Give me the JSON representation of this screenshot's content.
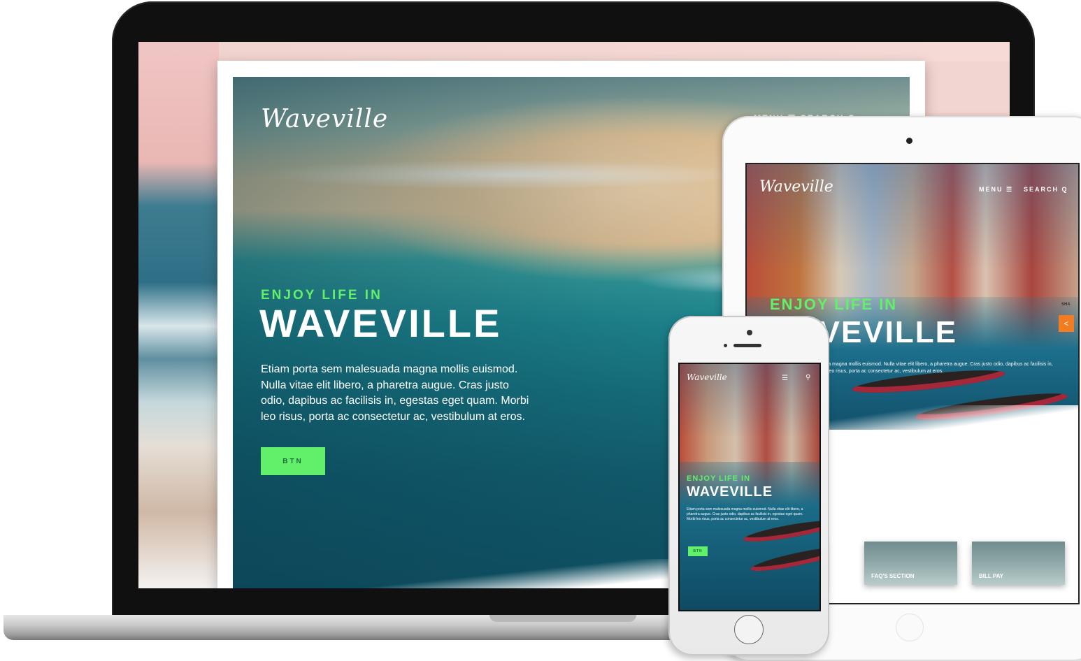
{
  "laptop": {
    "logo": "Waveville",
    "nav": "MENU ☰   SEARCH Q",
    "kicker": "ENJOY LIFE IN",
    "title": "WAVEVILLE",
    "body": "Etiam porta sem malesuada magna mollis euismod. Nulla vitae elit libero, a pharetra augue. Cras justo odio, dapibus ac facilisis in, egestas eget quam. Morbi leo risus, porta ac consectetur ac, vestibulum at eros.",
    "button": "BTN"
  },
  "tablet": {
    "logo": "Waveville",
    "menu": "MENU ☰",
    "search": "SEARCH Q",
    "kicker": "ENJOY LIFE IN",
    "title": "WAVEVILLE",
    "body": "Etiam porta sem malesuada magna mollis euismod. Nulla vitae elit libero, a pharetra augue. Cras justo odio, dapibus ac facilisis in, egestas eget quam. Morbi leo risus, porta ac consectetur ac, vestibulum at eros.",
    "share_label": "SHA",
    "share_icon": "share-icon",
    "cards": [
      {
        "label": ""
      },
      {
        "label": "FAQ'S SECTION"
      },
      {
        "label": "BILL PAY"
      }
    ]
  },
  "phone": {
    "logo": "Waveville",
    "menu_icon": "☰",
    "search_icon": "🔍",
    "kicker": "ENJOY LIFE IN",
    "title": "WAVEVILLE",
    "body": "Etiam porta sem malesuada magna mollis euismod. Nulla vitae elit libero, a pharetra augue. Cras justo odio, dapibus ac facilisis in, egestas eget quam. Morbi leo risus, porta ac consectetur ac, vestibulum at eros.",
    "button": "BTN"
  },
  "colors": {
    "accent": "#62f06a",
    "share": "#f47c20",
    "ocean": "#17707e"
  }
}
